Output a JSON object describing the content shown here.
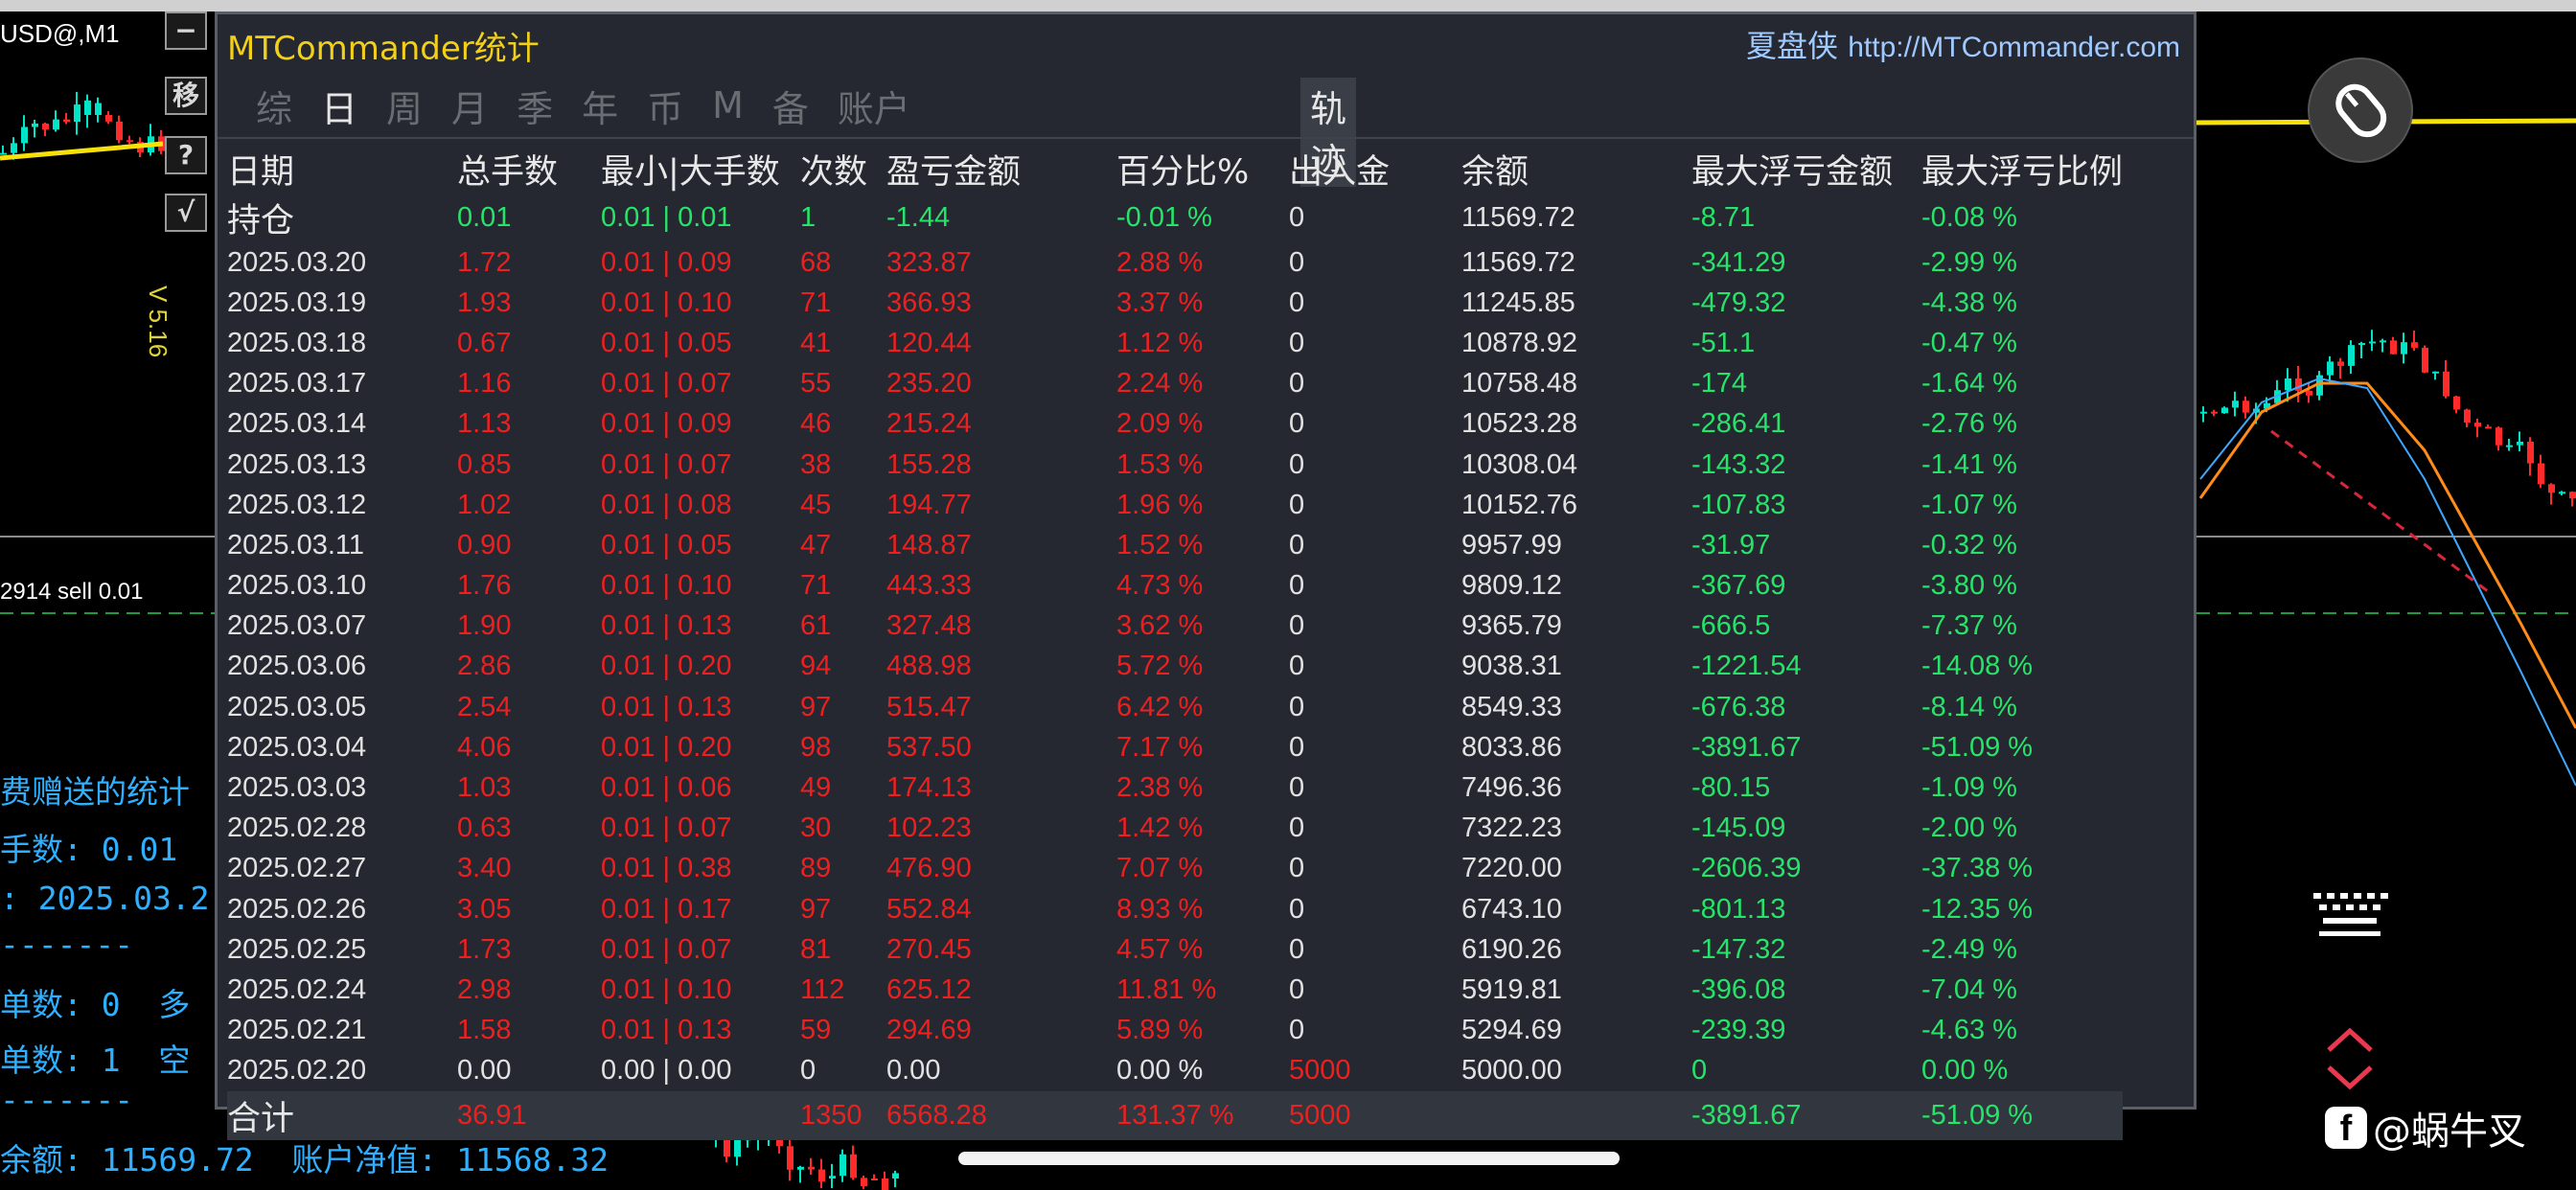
{
  "chart_bg": {
    "symbol": "USD@,M1",
    "side_buttons": [
      "−",
      "移",
      "?",
      "√"
    ],
    "version": "V 5.16",
    "order_label": "2914 sell 0.01",
    "left_info": [
      "费赠送的统计",
      "手数: 0.01",
      ": 2025.03.2",
      "-------",
      "单数: 0  多",
      "单数: 1  空",
      "-------",
      "余额: 11569.72  账户净值: 11568.32",
      "..."
    ],
    "colors": {
      "bull_candle": "#00e5c8",
      "bear_candle": "#ff2a2a",
      "ma_yellow": "#f7e10a",
      "ma_orange": "#ff8c1a",
      "ma_blue": "#3ea8ff"
    }
  },
  "panel": {
    "title": "MTCommander统计",
    "brand": "夏盘侠",
    "url": "http://MTCommander.com",
    "tabs": [
      "综",
      "日",
      "周",
      "月",
      "季",
      "年",
      "币",
      "M",
      "备",
      "账户"
    ],
    "active_tab": "日",
    "track_tab": "轨迹",
    "headers": [
      "日期",
      "总手数",
      "最小|大手数",
      "次数",
      "盈亏金额",
      "百分比%",
      "出入金",
      "余额",
      "最大浮亏金额",
      "最大浮亏比例"
    ],
    "holding": {
      "label": "持仓",
      "total": "0.01",
      "minmax": "0.01 | 0.01",
      "count": "1",
      "pl": "-1.44",
      "pct": "-0.01 %",
      "io": "0",
      "bal": "11569.72",
      "mfa": "-8.71",
      "mfr": "-0.08 %"
    },
    "rows": [
      [
        "2025.03.20",
        "1.72",
        "0.01 | 0.09",
        "68",
        "323.87",
        "2.88 %",
        "0",
        "11569.72",
        "-341.29",
        "-2.99 %"
      ],
      [
        "2025.03.19",
        "1.93",
        "0.01 | 0.10",
        "71",
        "366.93",
        "3.37 %",
        "0",
        "11245.85",
        "-479.32",
        "-4.38 %"
      ],
      [
        "2025.03.18",
        "0.67",
        "0.01 | 0.05",
        "41",
        "120.44",
        "1.12 %",
        "0",
        "10878.92",
        "-51.1",
        "-0.47 %"
      ],
      [
        "2025.03.17",
        "1.16",
        "0.01 | 0.07",
        "55",
        "235.20",
        "2.24 %",
        "0",
        "10758.48",
        "-174",
        "-1.64 %"
      ],
      [
        "2025.03.14",
        "1.13",
        "0.01 | 0.09",
        "46",
        "215.24",
        "2.09 %",
        "0",
        "10523.28",
        "-286.41",
        "-2.76 %"
      ],
      [
        "2025.03.13",
        "0.85",
        "0.01 | 0.07",
        "38",
        "155.28",
        "1.53 %",
        "0",
        "10308.04",
        "-143.32",
        "-1.41 %"
      ],
      [
        "2025.03.12",
        "1.02",
        "0.01 | 0.08",
        "45",
        "194.77",
        "1.96 %",
        "0",
        "10152.76",
        "-107.83",
        "-1.07 %"
      ],
      [
        "2025.03.11",
        "0.90",
        "0.01 | 0.05",
        "47",
        "148.87",
        "1.52 %",
        "0",
        "9957.99",
        "-31.97",
        "-0.32 %"
      ],
      [
        "2025.03.10",
        "1.76",
        "0.01 | 0.10",
        "71",
        "443.33",
        "4.73 %",
        "0",
        "9809.12",
        "-367.69",
        "-3.80 %"
      ],
      [
        "2025.03.07",
        "1.90",
        "0.01 | 0.13",
        "61",
        "327.48",
        "3.62 %",
        "0",
        "9365.79",
        "-666.5",
        "-7.37 %"
      ],
      [
        "2025.03.06",
        "2.86",
        "0.01 | 0.20",
        "94",
        "488.98",
        "5.72 %",
        "0",
        "9038.31",
        "-1221.54",
        "-14.08 %"
      ],
      [
        "2025.03.05",
        "2.54",
        "0.01 | 0.13",
        "97",
        "515.47",
        "6.42 %",
        "0",
        "8549.33",
        "-676.38",
        "-8.14 %"
      ],
      [
        "2025.03.04",
        "4.06",
        "0.01 | 0.20",
        "98",
        "537.50",
        "7.17 %",
        "0",
        "8033.86",
        "-3891.67",
        "-51.09 %"
      ],
      [
        "2025.03.03",
        "1.03",
        "0.01 | 0.06",
        "49",
        "174.13",
        "2.38 %",
        "0",
        "7496.36",
        "-80.15",
        "-1.09 %"
      ],
      [
        "2025.02.28",
        "0.63",
        "0.01 | 0.07",
        "30",
        "102.23",
        "1.42 %",
        "0",
        "7322.23",
        "-145.09",
        "-2.00 %"
      ],
      [
        "2025.02.27",
        "3.40",
        "0.01 | 0.38",
        "89",
        "476.90",
        "7.07 %",
        "0",
        "7220.00",
        "-2606.39",
        "-37.38 %"
      ],
      [
        "2025.02.26",
        "3.05",
        "0.01 | 0.17",
        "97",
        "552.84",
        "8.93 %",
        "0",
        "6743.10",
        "-801.13",
        "-12.35 %"
      ],
      [
        "2025.02.25",
        "1.73",
        "0.01 | 0.07",
        "81",
        "270.45",
        "4.57 %",
        "0",
        "6190.26",
        "-147.32",
        "-2.49 %"
      ],
      [
        "2025.02.24",
        "2.98",
        "0.01 | 0.10",
        "112",
        "625.12",
        "11.81 %",
        "0",
        "5919.81",
        "-396.08",
        "-7.04 %"
      ],
      [
        "2025.02.21",
        "1.58",
        "0.01 | 0.13",
        "59",
        "294.69",
        "5.89 %",
        "0",
        "5294.69",
        "-239.39",
        "-4.63 %"
      ],
      [
        "2025.02.20",
        "0.00",
        "0.00 | 0.00",
        "0",
        "0.00",
        "0.00 %",
        "5000",
        "5000.00",
        "0",
        "0.00 %"
      ]
    ],
    "total": {
      "label": "合计",
      "total": "36.91",
      "minmax": "",
      "count": "1350",
      "pl": "6568.28",
      "pct": "131.37 %",
      "io": "5000",
      "bal": "",
      "mfa": "-3891.67",
      "mfr": "-51.09 %"
    }
  },
  "watermark": {
    "logo": "f",
    "name": "@蜗牛㕚"
  },
  "icons": [
    "mouse-icon",
    "keyboard-icon",
    "nav-chevron-icon"
  ]
}
